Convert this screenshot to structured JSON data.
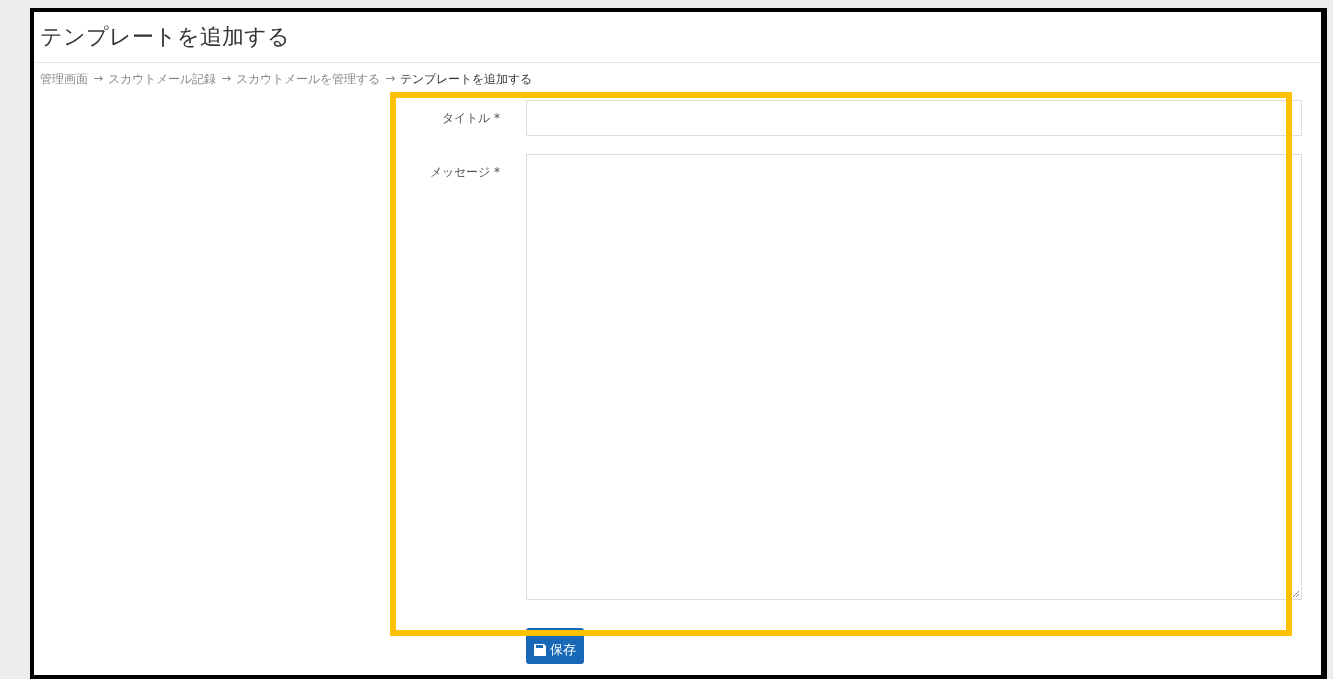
{
  "page_title": "テンプレートを追加する",
  "breadcrumb": {
    "separator": "→",
    "items": [
      {
        "label": "管理画面",
        "current": false
      },
      {
        "label": "スカウトメール記録",
        "current": false
      },
      {
        "label": "スカウトメールを管理する",
        "current": false
      },
      {
        "label": "テンプレートを追加する",
        "current": true
      }
    ]
  },
  "form": {
    "fields": [
      {
        "label": "タイトル",
        "required_mark": "*",
        "kind": "input"
      },
      {
        "label": "メッセージ",
        "required_mark": "*",
        "kind": "textarea"
      }
    ],
    "save_button": "保存"
  },
  "highlight_frame": true
}
